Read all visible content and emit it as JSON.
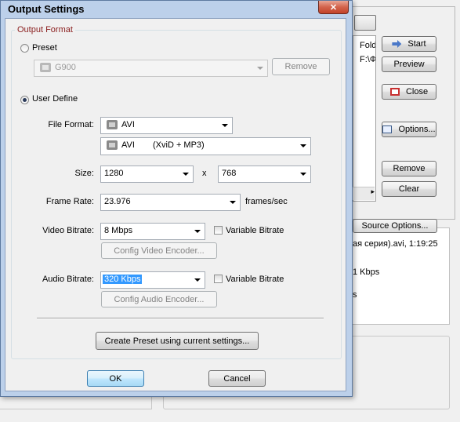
{
  "background_app": {
    "list_items": [
      "Fold",
      "F:\\Фі"
    ],
    "buttons": {
      "start": "Start",
      "preview": "Preview",
      "close": "Close",
      "options": "Options...",
      "remove": "Remove",
      "clear": "Clear",
      "source_options": "Source Options..."
    },
    "info_lines": [
      "ая серия).avi, 1:19:25",
      "1 Kbps",
      "s"
    ]
  },
  "dialog": {
    "title": "Output Settings",
    "close_glyph": "✕",
    "group_title": "Output Format",
    "preset": {
      "label": "Preset",
      "value": "G900",
      "remove_label": "Remove"
    },
    "user_define": {
      "label": "User Define"
    },
    "file_format": {
      "label": "File Format:",
      "value": "AVI",
      "codec_value": "AVI",
      "codec_detail": "(XviD + MP3)"
    },
    "size": {
      "label": "Size:",
      "width": "1280",
      "separator": "x",
      "height": "768"
    },
    "frame_rate": {
      "label": "Frame Rate:",
      "value": "23.976",
      "unit": "frames/sec"
    },
    "video_bitrate": {
      "label": "Video Bitrate:",
      "value": "8 Mbps",
      "variable_label": "Variable Bitrate",
      "config_label": "Config Video Encoder..."
    },
    "audio_bitrate": {
      "label": "Audio Bitrate:",
      "value": "320 Kbps",
      "variable_label": "Variable Bitrate",
      "config_label": "Config Audio Encoder..."
    },
    "create_preset_label": "Create Preset using current settings...",
    "ok_label": "OK",
    "cancel_label": "Cancel"
  }
}
